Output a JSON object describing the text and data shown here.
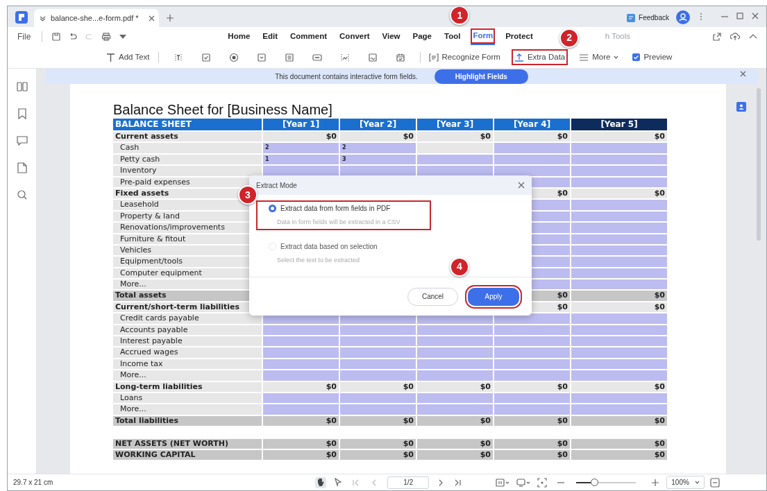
{
  "tabs": [
    {
      "label": "balance-she...e-form.pdf *",
      "selected": true
    }
  ],
  "feedback": "Feedback",
  "file_menu": "File",
  "menu": [
    {
      "label": "Home",
      "selected": false,
      "disabled": false
    },
    {
      "label": "Edit",
      "selected": false,
      "disabled": false
    },
    {
      "label": "Comment",
      "selected": false,
      "disabled": false
    },
    {
      "label": "Convert",
      "selected": false,
      "disabled": false
    },
    {
      "label": "View",
      "selected": false,
      "disabled": false
    },
    {
      "label": "Page",
      "selected": false,
      "disabled": false
    },
    {
      "label": "Tool",
      "selected": false,
      "disabled": false
    },
    {
      "label": "Form",
      "selected": true,
      "disabled": false,
      "highlighted": true,
      "callout": "1"
    },
    {
      "label": "Protect",
      "selected": false,
      "disabled": false
    },
    {
      "label": "h Tools",
      "selected": false,
      "disabled": true
    }
  ],
  "toolbar": {
    "add_text": "Add Text",
    "tools": [
      {
        "label": "Recognize Form",
        "highlighted": false
      },
      {
        "label": "Extra Data",
        "highlighted": true,
        "callout": "2"
      },
      {
        "label": "More",
        "highlighted": false
      }
    ],
    "preview": {
      "label": "Preview",
      "checked": true
    }
  },
  "notice": {
    "text": "This document contains interactive form fields.",
    "button": "Highlight Fields"
  },
  "document": {
    "title": "Balance Sheet for [Business Name]",
    "columns": [
      "BALANCE SHEET",
      "[Year 1]",
      "[Year 2]",
      "[Year 3]",
      "[Year 4]",
      "[Year 5]"
    ],
    "rows": [
      {
        "label": "Current assets",
        "kind": "section",
        "cells": [
          {
            "kind": "amount",
            "text": "$0"
          },
          {
            "kind": "amount",
            "text": "$0"
          },
          {
            "kind": "amount",
            "text": "$0"
          },
          {
            "kind": "amount",
            "text": "$0"
          },
          {
            "kind": "amount",
            "text": "$0"
          }
        ]
      },
      {
        "label": "Cash",
        "kind": "item",
        "cells": [
          {
            "kind": "field",
            "text": "2"
          },
          {
            "kind": "field",
            "text": "2"
          },
          {
            "kind": "plain"
          },
          {
            "kind": "field"
          },
          {
            "kind": "field"
          }
        ]
      },
      {
        "label": "Petty cash",
        "kind": "item",
        "cells": [
          {
            "kind": "field",
            "text": "1"
          },
          {
            "kind": "field",
            "text": "3"
          },
          {
            "kind": "field"
          },
          {
            "kind": "field"
          },
          {
            "kind": "field"
          }
        ]
      },
      {
        "label": "Inventory",
        "kind": "item",
        "cells": [
          {
            "kind": "field"
          },
          {
            "kind": "field"
          },
          {
            "kind": "field"
          },
          {
            "kind": "field"
          },
          {
            "kind": "field"
          }
        ]
      },
      {
        "label": "Pre-paid expenses",
        "kind": "item",
        "cells": [
          {
            "kind": "covered"
          },
          {
            "kind": "covered"
          },
          {
            "kind": "covered"
          },
          {
            "kind": "field"
          },
          {
            "kind": "field"
          }
        ]
      },
      {
        "label": "Fixed assets",
        "kind": "section",
        "cells": [
          {
            "kind": "covered"
          },
          {
            "kind": "covered"
          },
          {
            "kind": "covered"
          },
          {
            "kind": "amount",
            "text": "$0"
          },
          {
            "kind": "amount",
            "text": "$0"
          }
        ]
      },
      {
        "label": "Leasehold",
        "kind": "item",
        "cells": [
          {
            "kind": "covered"
          },
          {
            "kind": "covered"
          },
          {
            "kind": "covered"
          },
          {
            "kind": "field"
          },
          {
            "kind": "field"
          }
        ]
      },
      {
        "label": "Property & land",
        "kind": "item",
        "cells": [
          {
            "kind": "covered"
          },
          {
            "kind": "covered"
          },
          {
            "kind": "covered"
          },
          {
            "kind": "field"
          },
          {
            "kind": "field"
          }
        ]
      },
      {
        "label": "Renovations/improvements",
        "kind": "item",
        "cells": [
          {
            "kind": "covered"
          },
          {
            "kind": "covered"
          },
          {
            "kind": "covered"
          },
          {
            "kind": "field"
          },
          {
            "kind": "field"
          }
        ]
      },
      {
        "label": "Furniture & fitout",
        "kind": "item",
        "cells": [
          {
            "kind": "covered"
          },
          {
            "kind": "covered"
          },
          {
            "kind": "covered"
          },
          {
            "kind": "field"
          },
          {
            "kind": "field"
          }
        ]
      },
      {
        "label": "Vehicles",
        "kind": "item",
        "cells": [
          {
            "kind": "covered"
          },
          {
            "kind": "covered"
          },
          {
            "kind": "covered"
          },
          {
            "kind": "field"
          },
          {
            "kind": "field"
          }
        ]
      },
      {
        "label": "Equipment/tools",
        "kind": "item",
        "cells": [
          {
            "kind": "covered"
          },
          {
            "kind": "covered"
          },
          {
            "kind": "covered"
          },
          {
            "kind": "field"
          },
          {
            "kind": "field"
          }
        ]
      },
      {
        "label": "Computer equipment",
        "kind": "item",
        "cells": [
          {
            "kind": "covered"
          },
          {
            "kind": "covered"
          },
          {
            "kind": "covered"
          },
          {
            "kind": "field"
          },
          {
            "kind": "field"
          }
        ]
      },
      {
        "label": "More...",
        "kind": "item",
        "cells": [
          {
            "kind": "covered"
          },
          {
            "kind": "covered"
          },
          {
            "kind": "covered"
          },
          {
            "kind": "field"
          },
          {
            "kind": "field"
          }
        ]
      },
      {
        "label": "Total assets",
        "kind": "total",
        "cells": [
          {
            "kind": "covered"
          },
          {
            "kind": "covered"
          },
          {
            "kind": "covered"
          },
          {
            "kind": "amount",
            "text": "$0"
          },
          {
            "kind": "amount",
            "text": "$0"
          }
        ]
      },
      {
        "label": "Current/short-term liabilities",
        "kind": "section",
        "cells": [
          {
            "kind": "covered"
          },
          {
            "kind": "covered"
          },
          {
            "kind": "covered"
          },
          {
            "kind": "amount",
            "text": "$0"
          },
          {
            "kind": "amount",
            "text": "$0"
          }
        ]
      },
      {
        "label": "Credit cards payable",
        "kind": "item",
        "cells": [
          {
            "kind": "field"
          },
          {
            "kind": "field"
          },
          {
            "kind": "field"
          },
          {
            "kind": "field"
          },
          {
            "kind": "field"
          }
        ]
      },
      {
        "label": "Accounts payable",
        "kind": "item",
        "cells": [
          {
            "kind": "field"
          },
          {
            "kind": "field"
          },
          {
            "kind": "field"
          },
          {
            "kind": "field"
          },
          {
            "kind": "field"
          }
        ]
      },
      {
        "label": "Interest payable",
        "kind": "item",
        "cells": [
          {
            "kind": "field"
          },
          {
            "kind": "field"
          },
          {
            "kind": "field"
          },
          {
            "kind": "field"
          },
          {
            "kind": "field"
          }
        ]
      },
      {
        "label": "Accrued wages",
        "kind": "item",
        "cells": [
          {
            "kind": "field"
          },
          {
            "kind": "field"
          },
          {
            "kind": "field"
          },
          {
            "kind": "field"
          },
          {
            "kind": "field"
          }
        ]
      },
      {
        "label": "Income tax",
        "kind": "item",
        "cells": [
          {
            "kind": "field"
          },
          {
            "kind": "field"
          },
          {
            "kind": "field"
          },
          {
            "kind": "field"
          },
          {
            "kind": "field"
          }
        ]
      },
      {
        "label": "More...",
        "kind": "item",
        "cells": [
          {
            "kind": "field"
          },
          {
            "kind": "field"
          },
          {
            "kind": "field"
          },
          {
            "kind": "field"
          },
          {
            "kind": "field"
          }
        ]
      },
      {
        "label": "Long-term liabilities",
        "kind": "section",
        "cells": [
          {
            "kind": "amount",
            "text": "$0"
          },
          {
            "kind": "amount",
            "text": "$0"
          },
          {
            "kind": "amount",
            "text": "$0"
          },
          {
            "kind": "amount",
            "text": "$0"
          },
          {
            "kind": "amount",
            "text": "$0"
          }
        ]
      },
      {
        "label": "Loans",
        "kind": "item",
        "cells": [
          {
            "kind": "field"
          },
          {
            "kind": "field"
          },
          {
            "kind": "field"
          },
          {
            "kind": "field"
          },
          {
            "kind": "field"
          }
        ]
      },
      {
        "label": "More...",
        "kind": "item",
        "cells": [
          {
            "kind": "field"
          },
          {
            "kind": "field"
          },
          {
            "kind": "field"
          },
          {
            "kind": "field"
          },
          {
            "kind": "field"
          }
        ]
      },
      {
        "label": "Total liabilities",
        "kind": "total",
        "cells": [
          {
            "kind": "amount",
            "text": "$0"
          },
          {
            "kind": "amount",
            "text": "$0"
          },
          {
            "kind": "amount",
            "text": "$0"
          },
          {
            "kind": "amount",
            "text": "$0"
          },
          {
            "kind": "amount",
            "text": "$0"
          }
        ]
      },
      {
        "kind": "spacer"
      },
      {
        "label": "NET ASSETS (NET WORTH)",
        "kind": "total",
        "cells": [
          {
            "kind": "amount",
            "text": "$0"
          },
          {
            "kind": "amount",
            "text": "$0"
          },
          {
            "kind": "amount",
            "text": "$0"
          },
          {
            "kind": "amount",
            "text": "$0"
          },
          {
            "kind": "amount",
            "text": "$0"
          }
        ]
      },
      {
        "label": "WORKING CAPITAL",
        "kind": "total",
        "cells": [
          {
            "kind": "amount",
            "text": "$0"
          },
          {
            "kind": "amount",
            "text": "$0"
          },
          {
            "kind": "amount",
            "text": "$0"
          },
          {
            "kind": "amount",
            "text": "$0"
          },
          {
            "kind": "amount",
            "text": "$0"
          }
        ]
      }
    ]
  },
  "dialog": {
    "title": "Extract Mode",
    "options": [
      {
        "label": "Extract data from form fields in PDF",
        "description": "Data in form fields will be extracted in a CSV",
        "selected": true,
        "disabled": false,
        "highlighted": true,
        "callout": "3"
      },
      {
        "label": "Extract data based on selection",
        "description": "Select the text to be extracted",
        "selected": false,
        "disabled": true
      }
    ],
    "buttons": [
      {
        "label": "Cancel",
        "kind": "secondary"
      },
      {
        "label": "Apply",
        "kind": "primary",
        "highlighted": true,
        "callout": "4"
      }
    ]
  },
  "status_bar": {
    "page_size": "29.7 x 21 cm",
    "pointer_tools": [
      {
        "selected": true
      },
      {
        "selected": false
      }
    ],
    "page": "1/2",
    "zoom_slider": {
      "level": 0.3
    },
    "zoom": "100%"
  }
}
